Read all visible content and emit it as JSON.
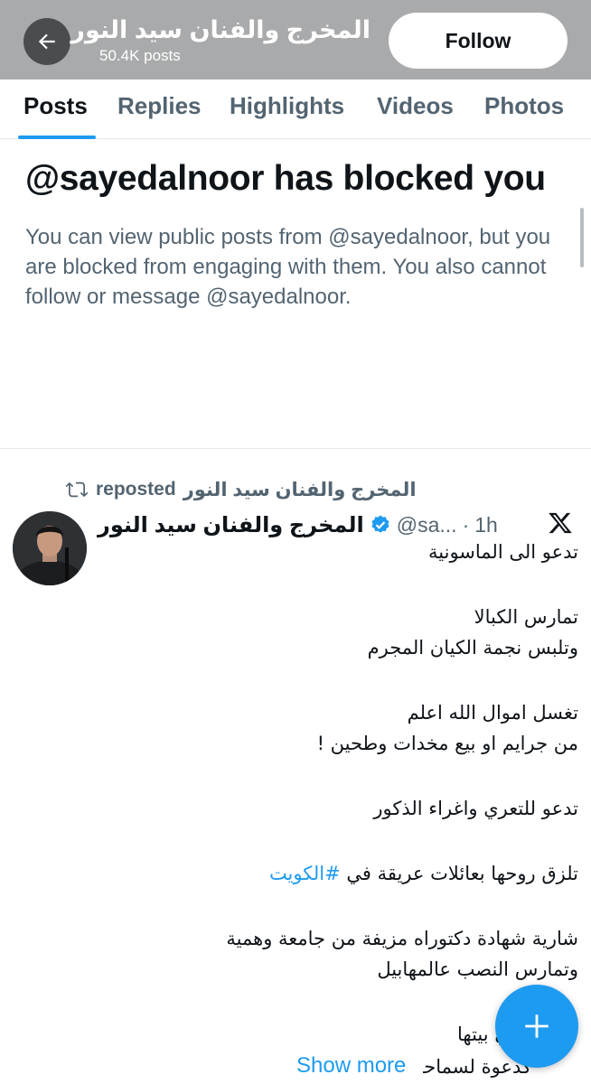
{
  "header": {
    "name": "المخرج والفنان سيد النور",
    "posts_count": "50.4K posts",
    "follow_label": "Follow",
    "back_icon": "arrow-left-icon"
  },
  "tabs": [
    {
      "label": "Posts",
      "active": true
    },
    {
      "label": "Replies",
      "active": false
    },
    {
      "label": "Highlights",
      "active": false
    },
    {
      "label": "Videos",
      "active": false
    },
    {
      "label": "Photos",
      "active": false
    }
  ],
  "blocked": {
    "title": "@sayedalnoor has blocked you",
    "description": "You can view public posts from @sayedalnoor, but you are blocked from engaging with them. You also cannot follow or message @sayedalnoor."
  },
  "repost": {
    "reposter": "المخرج والفنان سيد النور",
    "suffix": "reposted",
    "icon": "repost-icon"
  },
  "post": {
    "author": "المخرج والفنان سيد النور",
    "verified_icon": "verified-badge-icon",
    "handle": "@sa...",
    "separator": "·",
    "time": "1h",
    "source_icon": "x-logo-icon",
    "lines": [
      "تدعو الى الماسونية",
      "",
      "تمارس الكبالا",
      "وتلبس نجمة الكيان المجرم",
      "",
      "تغسل اموال الله اعلم",
      "من جرايم او بيع مخدات وطحين !",
      "",
      "تدعو للتعري واغراء الذكور",
      "",
      "تلزق روحها بعائلات عريقة في",
      "",
      "شارية شهادة دكتوراه مزيفة من جامعة وهمية",
      "وتمارس النصب عالمهابيل",
      "",
      "تستهتر في بيتها"
    ],
    "hashtag": "#الكويت",
    "last_line_partial": "كدعوة لسماحة",
    "show_more": "Show more"
  },
  "fab": {
    "icon": "plus-icon",
    "color": "#1d9bf0"
  },
  "colors": {
    "accent": "#1d9bf0",
    "text": "#0f1419",
    "muted": "#536471",
    "header_bg": "#a9aaab"
  }
}
